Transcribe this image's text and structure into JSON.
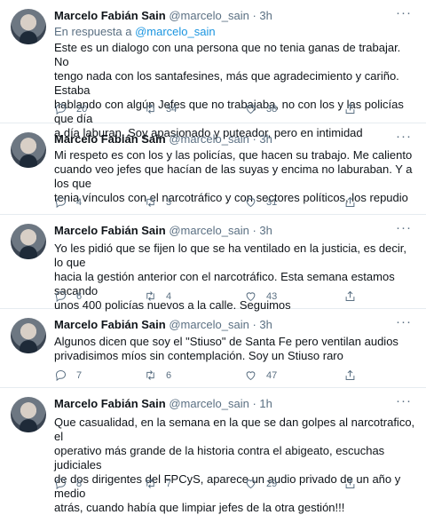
{
  "tweets": [
    {
      "name": "Marcelo Fabián Sain",
      "handle": "@marcelo_sain",
      "time": "3h",
      "reply_prefix": "En respuesta a ",
      "reply_to": "@marcelo_sain",
      "text": "Este es un dialogo con una persona que no tenia ganas de trabajar. No\ntengo nada con los santafesines, más que agradecimiento y cariño. Estaba\nhablando con algún Jefes que no trabajaba, no con los y las policías que día\na día laburan. Soy apasionado y puteador, pero en intimidad",
      "replies": "20",
      "retweets": "34",
      "likes": "38"
    },
    {
      "name": "Marcelo Fabián Sain",
      "handle": "@marcelo_sain",
      "time": "3h",
      "text": "Mi respeto es con los y las policías, que hacen su trabajo. Me caliento\ncuando veo jefes que hacían de las suyas y encima no laburaban. Y a los que\ntenia vínculos con el narcotráfico y con sectores políticos, los repudio",
      "replies": "4",
      "retweets": "3",
      "likes": "31"
    },
    {
      "name": "Marcelo Fabián Sain",
      "handle": "@marcelo_sain",
      "time": "3h",
      "text": "Yo les pidió que se fijen lo que se ha ventilado en la justicia, es decir, lo que\nhacia la gestión anterior con el narcotráfico. Esta semana estamos sacando\nunos 400 policías nuevos a la calle. Seguimos",
      "replies": "6",
      "retweets": "4",
      "likes": "43"
    },
    {
      "name": "Marcelo Fabián Sain",
      "handle": "@marcelo_sain",
      "time": "3h",
      "text": "Algunos dicen que soy el \"Stiuso\" de Santa Fe pero ventilan audios\nprivadisimos míos sin contemplación. Soy un Stiuso raro",
      "replies": "7",
      "retweets": "6",
      "likes": "47"
    },
    {
      "name": "Marcelo Fabián Sain",
      "handle": "@marcelo_sain",
      "time": "1h",
      "text": "Que casualidad, en la semana en la que se dan golpes al narcotrafico, el\noperativo más grande de la historia contra el abigeato, escuchas judiciales\nde dos dirigentes del FPCyS, aparece un audio privado de un año y medio\natrás, cuando había que limpiar jefes de la otra gestión!!!",
      "replies": "8",
      "retweets": "7",
      "likes": "29"
    }
  ],
  "icons": {
    "reply": "reply-icon",
    "retweet": "retweet-icon",
    "like": "heart-icon",
    "share": "share-icon",
    "more": "more-options-icon"
  }
}
